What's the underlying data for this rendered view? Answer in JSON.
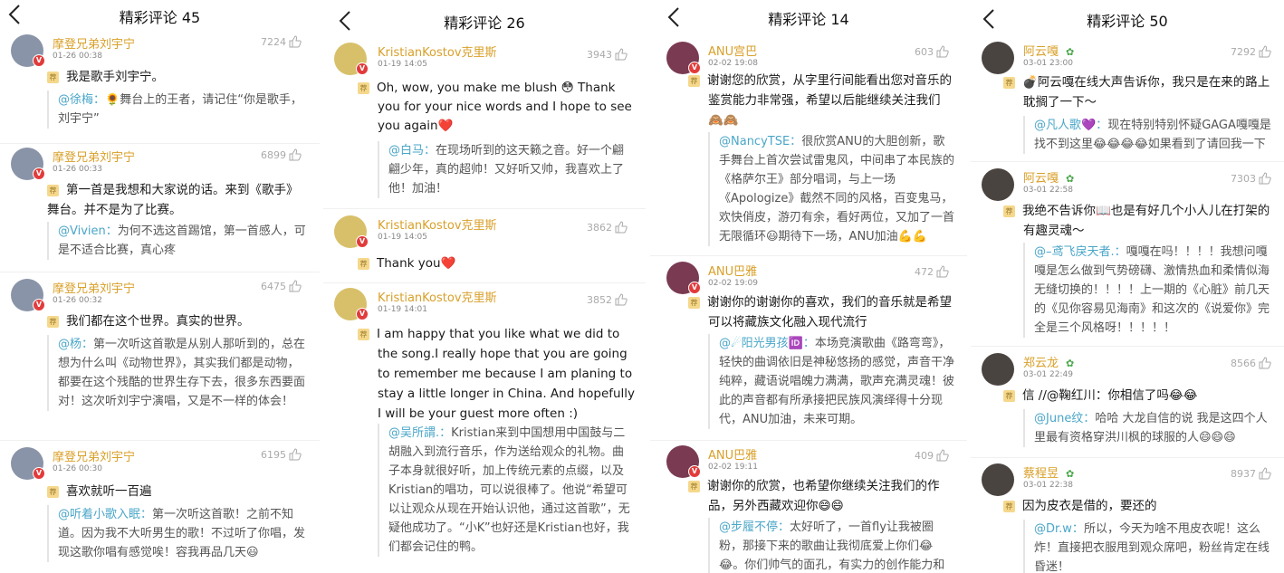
{
  "panels": [
    {
      "title": "精彩评论 45",
      "comments": [
        {
          "user": "摩登兄弟刘宇宁",
          "time": "01-26 00:38",
          "likes": "7224",
          "text": "我是歌手刘宇宁。",
          "reply_user": "@徐梅：",
          "reply_text": "🌻舞台上的王者，请记住“你是歌手，刘宇宁”"
        },
        {
          "user": "摩登兄弟刘宇宁",
          "time": "01-26 00:33",
          "likes": "6899",
          "text": "第一首是我想和大家说的话。来到《歌手》舞台。并不是为了比赛。",
          "reply_user": "@Vivien：",
          "reply_text": "为何不选这首踢馆，第一首感人，可是不适合比赛，真心疼"
        },
        {
          "user": "摩登兄弟刘宇宁",
          "time": "01-26 00:32",
          "likes": "6475",
          "text": "我们都在这个世界。真实的世界。",
          "reply_user": "@杨：",
          "reply_text": "第一次听这首歌是从别人那听到的，总在想为什么叫《动物世界》，其实我们都是动物，都要在这个残酷的世界生存下去，很多东西要面对！这次听刘宇宁演唱，又是不一样的体会！"
        },
        {
          "user": "摩登兄弟刘宇宁",
          "time": "01-26 00:30",
          "likes": "6195",
          "text": "喜欢就听一百遍",
          "reply_user": "@听着小歌入眠：",
          "reply_text": "第一次听这首歌！之前不知道。因为我不大听男生的歌！不过听了你唱，发现这歌你唱有感觉唉！容我再品几天😃"
        }
      ]
    },
    {
      "title": "精彩评论 26",
      "comments": [
        {
          "user": "KristianKostov克里斯",
          "time": "01-19 14:05",
          "likes": "3943",
          "text": "Oh, wow, you make me blush 😳 Thank you for your nice words and I hope to see you again❤️",
          "reply_user": "@白马：",
          "reply_text": "在现场听到的这天籁之音。好一个翩翩少年，真的超帅！又好听又帅，我喜欢上了他！加油！"
        },
        {
          "user": "KristianKostov克里斯",
          "time": "01-19 14:05",
          "likes": "3862",
          "text": "Thank you❤️",
          "reply_user": "",
          "reply_text": ""
        },
        {
          "user": "KristianKostov克里斯",
          "time": "01-19 14:01",
          "likes": "3852",
          "text": "I am happy that you like what we did to the song.I really hope that you are going to remember me because I am planing to stay a little longer in China. And hopefully I will be your guest more often :)",
          "reply_user": "@吴所謂.：",
          "reply_text": "Kristian来到中国想用中国鼓与二胡融入到流行音乐，作为送给观众的礼物。曲子本身就很好听，加上传统元素的点缀，以及Kristian的唱功，可以说很棒了。他说“希望可以让观众从现在开始认识他，通过这首歌”，无疑他成功了。“小K”也好还是Kristian也好，我们都会记住的鸭。"
        }
      ]
    },
    {
      "title": "精彩评论 14",
      "comments": [
        {
          "user": "ANU宫巴",
          "time": "02-02 19:08",
          "likes": "603",
          "text": "谢谢您的欣赏，从字里行间能看出您对音乐的鉴赏能力非常强，希望以后能继续关注我们🙈🙈",
          "reply_user": "@NancyTSE：",
          "reply_text": "很欣赏ANU的大胆创新，歌手舞台上首次尝试雷鬼风，中间串了本民族的《格萨尔王》部分唱词，与上一场《Apologize》截然不同的风格，百变鬼马，欢快俏皮，游刃有余，看好两位，又加了一首无限循环😃期待下一场，ANU加油💪💪"
        },
        {
          "user": "ANU巴雅",
          "time": "02-02 19:09",
          "likes": "472",
          "text": "谢谢你的谢谢你的喜欢，我们的音乐就是希望可以将藏族文化融入现代流行",
          "reply_user": "@☄阳光男孩🆔：",
          "reply_text": "本场竞演歌曲《路弯弯》，轻快的曲调依旧是神秘悠扬的感觉，声音干净纯粹，藏语说唱魄力满满，歌声充满灵魂！彼此的声音都有所承接把民族风演绎得十分现代，ANU加油，未来可期。"
        },
        {
          "user": "ANU巴雅",
          "time": "02-02 19:11",
          "likes": "409",
          "text": "谢谢你的欣赏，也希望你继续关注我们的作品，另外西藏欢迎你😄😄",
          "reply_user": "@步履不停：",
          "reply_text": "太好听了，一首fly让我被圈粉，那接下来的歌曲让我彻底爱上你们😂😂。你们帅气的面孔，有实力的创作能力和唱功，让"
        }
      ]
    },
    {
      "title": "精彩评论 50",
      "comments": [
        {
          "user": "阿云嘎",
          "vip": "✿",
          "time": "03-01 23:00",
          "likes": "7292",
          "text": "💣阿云嘎在线大声告诉你，我只是在来的路上耽搁了一下～",
          "reply_user": "@凡人歌💜：",
          "reply_text": "现在特别特别怀疑GAGA嘎嘎是找不到这里😂😂😂😂如果看到了请回我一下"
        },
        {
          "user": "阿云嘎",
          "vip": "✿",
          "time": "03-01 22:58",
          "likes": "7303",
          "text": "我绝不告诉你📖也是有好几个小人儿在打架的有趣灵魂～",
          "reply_user": "@–鸢飞戾天者.：",
          "reply_text": "嘎嘎在吗！！！！我想问嘎嘎是怎么做到气势磅礴、激情热血和柔情似海无缝切换的！！！！上一期的《心脏》前几天的《见你容易见海南》和这次的《说爱你》完全是三个风格呀！！！！！"
        },
        {
          "user": "郑云龙",
          "vip": "✿",
          "time": "03-01 22:49",
          "likes": "8566",
          "text": "信 //@鞠红川：你相信了吗😂😂",
          "reply_user": "@June纹：",
          "reply_text": "哈哈 大龙自信的说 我是这四个人里最有资格穿洪川枫的球服的人😄😄😄"
        },
        {
          "user": "蔡程昱",
          "vip": "✿",
          "time": "03-01 22:38",
          "likes": "8937",
          "text": "因为皮衣是借的，要还的",
          "reply_user": "@Dr.w：",
          "reply_text": "所以，今天为啥不甩皮衣呢！这么炸！直接把衣服甩到观众席吧，粉丝肯定在线昏迷！"
        }
      ]
    }
  ],
  "icons": {
    "back": "chevron-left-icon",
    "like": "thumbs-up-icon",
    "badge": "verified-v-icon",
    "tag": "hot-tag-icon"
  },
  "colors": {
    "username": "#d9a02a",
    "reply_user": "#4aa6c8",
    "verified": "#e23b3b",
    "vip": "#4aa64a"
  }
}
